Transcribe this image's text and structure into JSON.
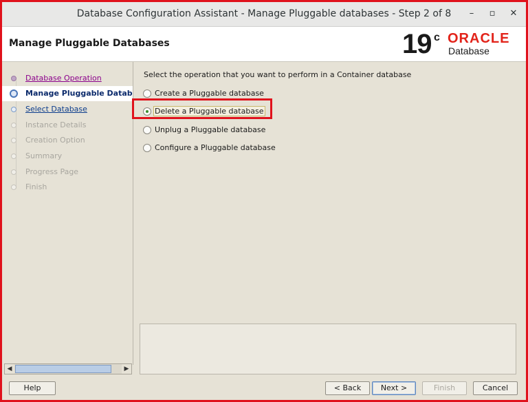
{
  "window": {
    "title": "Database Configuration Assistant - Manage Pluggable databases - Step 2 of 8",
    "minimize": "–",
    "maximize": "▫",
    "close": "✕"
  },
  "header": {
    "title": "Manage Pluggable Databases",
    "logo_version": "19",
    "logo_suffix": "c",
    "logo_brand": "ORACLE",
    "logo_product": "Database"
  },
  "nav": {
    "items": [
      {
        "label": "Database Operation",
        "state": "done"
      },
      {
        "label": "Manage Pluggable Databases",
        "state": "current"
      },
      {
        "label": "Select Database",
        "state": "link"
      },
      {
        "label": "Instance Details",
        "state": "disabled"
      },
      {
        "label": "Creation Option",
        "state": "disabled"
      },
      {
        "label": "Summary",
        "state": "disabled"
      },
      {
        "label": "Progress Page",
        "state": "disabled"
      },
      {
        "label": "Finish",
        "state": "disabled"
      }
    ]
  },
  "content": {
    "prompt": "Select the operation that you want to perform in a Container database",
    "options": [
      {
        "label": "Create a Pluggable database",
        "selected": false
      },
      {
        "label": "Delete a Pluggable database",
        "selected": true
      },
      {
        "label": "Unplug a Pluggable database",
        "selected": false
      },
      {
        "label": "Configure a Pluggable database",
        "selected": false
      }
    ]
  },
  "buttons": {
    "help": "Help",
    "back": "< Back",
    "next": "Next >",
    "finish": "Finish",
    "cancel": "Cancel"
  },
  "colors": {
    "highlight": "#e0121c",
    "oracle_red": "#e2231a"
  }
}
